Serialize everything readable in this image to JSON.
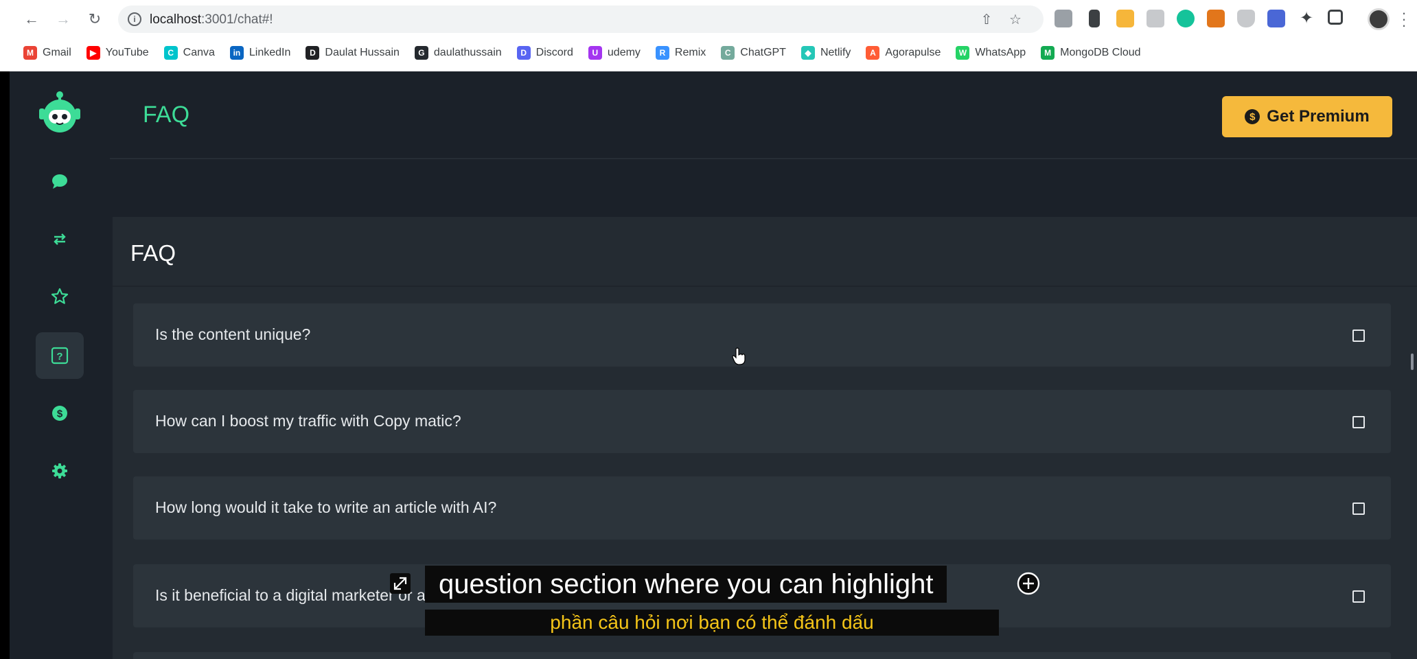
{
  "browser": {
    "url_host": "localhost",
    "url_path": ":3001/chat#!",
    "bookmarks": [
      {
        "label": "Gmail",
        "icon": "gmail-icon",
        "color": "#ea4335",
        "glyph": "M"
      },
      {
        "label": "YouTube",
        "icon": "youtube-icon",
        "color": "#ff0000",
        "glyph": "▶"
      },
      {
        "label": "Canva",
        "icon": "canva-icon",
        "color": "#00c4cc",
        "glyph": "C"
      },
      {
        "label": "LinkedIn",
        "icon": "linkedin-icon",
        "color": "#0a66c2",
        "glyph": "in"
      },
      {
        "label": "Daulat Hussain",
        "icon": "person-icon",
        "color": "#202124",
        "glyph": "D"
      },
      {
        "label": "daulathussain",
        "icon": "github-icon",
        "color": "#24292e",
        "glyph": "G"
      },
      {
        "label": "Discord",
        "icon": "discord-icon",
        "color": "#5865f2",
        "glyph": "D"
      },
      {
        "label": "udemy",
        "icon": "udemy-icon",
        "color": "#a435f0",
        "glyph": "U"
      },
      {
        "label": "Remix",
        "icon": "remix-icon",
        "color": "#3992ff",
        "glyph": "R"
      },
      {
        "label": "ChatGPT",
        "icon": "chatgpt-icon",
        "color": "#74aa9c",
        "glyph": "C"
      },
      {
        "label": "Netlify",
        "icon": "netlify-icon",
        "color": "#25c7b7",
        "glyph": "◆"
      },
      {
        "label": "Agorapulse",
        "icon": "agorapulse-icon",
        "color": "#ff5c35",
        "glyph": "A"
      },
      {
        "label": "WhatsApp",
        "icon": "whatsapp-icon",
        "color": "#25d366",
        "glyph": "W"
      },
      {
        "label": "MongoDB Cloud",
        "icon": "mongodb-icon",
        "color": "#13aa52",
        "glyph": "M"
      }
    ]
  },
  "header": {
    "title": "FAQ",
    "premium_label": "Get Premium"
  },
  "sidebar": {
    "items": [
      {
        "name": "chat",
        "icon": "chat-icon"
      },
      {
        "name": "transfer",
        "icon": "transfer-icon"
      },
      {
        "name": "favorites",
        "icon": "star-icon"
      },
      {
        "name": "faq",
        "icon": "question-icon",
        "active": true
      },
      {
        "name": "billing",
        "icon": "dollar-icon"
      },
      {
        "name": "settings",
        "icon": "gear-icon"
      }
    ]
  },
  "faq": {
    "title": "FAQ",
    "items": [
      {
        "question": "Is the content unique?"
      },
      {
        "question": "How can I boost my traffic with Copy matic?"
      },
      {
        "question": "How long would it take to write an article with AI?"
      },
      {
        "question": "Is it beneficial to a digital marketer or a content writer?"
      }
    ]
  },
  "captions": {
    "line1": "question section where you can highlight",
    "line2": "phần câu hỏi nơi bạn có thể đánh dấu"
  },
  "colors": {
    "accent": "#3ddc97",
    "premium": "#f5b93c",
    "background": "#1b2129",
    "panel": "#242b32",
    "card": "#2c343b"
  }
}
